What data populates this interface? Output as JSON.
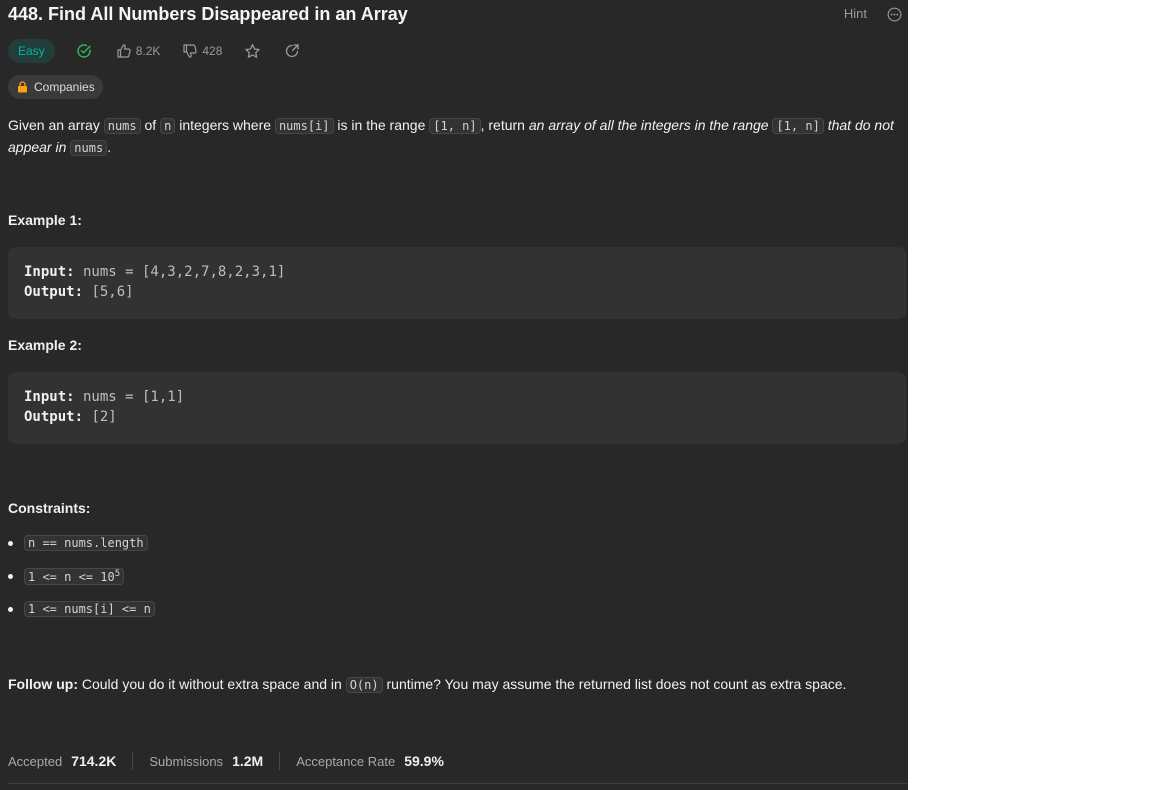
{
  "problem": {
    "title": "448. Find All Numbers Disappeared in an Array",
    "hint_label": "Hint",
    "difficulty": "Easy",
    "likes": "8.2K",
    "dislikes": "428",
    "companies_label": "Companies"
  },
  "description": {
    "t1": "Given an array ",
    "c1": "nums",
    "t2": " of ",
    "c2": "n",
    "t3": " integers where ",
    "c3": "nums[i]",
    "t4": " is in the range ",
    "c4": "[1, n]",
    "t5": ", return ",
    "em1": "an array of all the integers in the range ",
    "c5": "[1, n]",
    "em2": " that do not appear in ",
    "c6": "nums",
    "t6": "."
  },
  "examples": [
    {
      "heading": "Example 1:",
      "input_label": "Input:",
      "input_value": " nums = [4,3,2,7,8,2,3,1]",
      "output_label": "Output:",
      "output_value": " [5,6]"
    },
    {
      "heading": "Example 2:",
      "input_label": "Input:",
      "input_value": " nums = [1,1]",
      "output_label": "Output:",
      "output_value": " [2]"
    }
  ],
  "constraints": {
    "heading": "Constraints:",
    "c1": "n == nums.length",
    "c2_base": "1 <= n <= 10",
    "c2_sup": "5",
    "c3": "1 <= nums[i] <= n"
  },
  "followup": {
    "label": "Follow up:",
    "t1": " Could you do it without extra space and in ",
    "code": "O(n)",
    "t2": " runtime? You may assume the returned list does not count as extra space."
  },
  "stats": {
    "accepted_label": "Accepted",
    "accepted_value": "714.2K",
    "submissions_label": "Submissions",
    "submissions_value": "1.2M",
    "rate_label": "Acceptance Rate",
    "rate_value": "59.9%"
  },
  "colors": {
    "background": "#282828",
    "easy": "#00b8a3",
    "solved_check": "#2cbb5d"
  }
}
